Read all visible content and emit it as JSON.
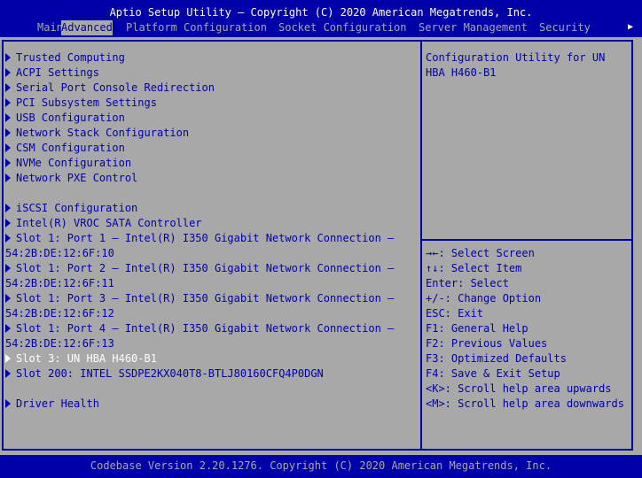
{
  "header": {
    "title": "Aptio Setup Utility – Copyright (C) 2020 American Megatrends, Inc.",
    "tabs": [
      {
        "label": "Main",
        "active": false
      },
      {
        "label": "Advanced",
        "active": true
      },
      {
        "label": "Platform Configuration",
        "active": false
      },
      {
        "label": "Socket Configuration",
        "active": false
      },
      {
        "label": "Server Management",
        "active": false
      },
      {
        "label": "Security",
        "active": false
      }
    ],
    "more_icon": "right-arrow-icon"
  },
  "menu": {
    "items": [
      {
        "label": "Trusted Computing"
      },
      {
        "label": "ACPI Settings"
      },
      {
        "label": "Serial Port Console Redirection"
      },
      {
        "label": "PCI Subsystem Settings"
      },
      {
        "label": "USB Configuration"
      },
      {
        "label": "Network Stack Configuration"
      },
      {
        "label": "CSM Configuration"
      },
      {
        "label": "NVMe Configuration"
      },
      {
        "label": "Network PXE Control"
      },
      {
        "label": "iSCSI Configuration"
      },
      {
        "label": "Intel(R) VROC SATA Controller"
      },
      {
        "label": "Slot 1: Port 1 – Intel(R) I350 Gigabit Network Connection –",
        "cont": "54:2B:DE:12:6F:10"
      },
      {
        "label": "Slot 1: Port 2 – Intel(R) I350 Gigabit Network Connection –",
        "cont": "54:2B:DE:12:6F:11"
      },
      {
        "label": "Slot 1: Port 3 – Intel(R) I350 Gigabit Network Connection –",
        "cont": "54:2B:DE:12:6F:12"
      },
      {
        "label": "Slot 1: Port 4 – Intel(R) I350 Gigabit Network Connection –",
        "cont": "54:2B:DE:12:6F:13"
      },
      {
        "label": "Slot 3: UN HBA H460-B1",
        "selected": true
      },
      {
        "label": "Slot 200: INTEL SSDPE2KX040T8-BTLJ80160CFQ4P0DGN"
      },
      {
        "label": "Driver Health"
      }
    ]
  },
  "help": {
    "description": "Configuration Utility for UN\nHBA H460-B1",
    "keys": [
      "→←: Select Screen",
      "↑↓: Select Item",
      "Enter: Select",
      "+/-: Change Option",
      "ESC: Exit",
      "F1: General Help",
      "F2: Previous Values",
      "F3: Optimized Defaults",
      "F4: Save & Exit Setup",
      "<K>: Scroll help area upwards",
      "<M>: Scroll help area downwards"
    ]
  },
  "footer": {
    "text": "Codebase Version 2.20.1276. Copyright (C) 2020 American Megatrends, Inc."
  },
  "colors": {
    "background": "#0000a8",
    "panel": "#a8a8a8",
    "selected_text": "#ffffff"
  }
}
